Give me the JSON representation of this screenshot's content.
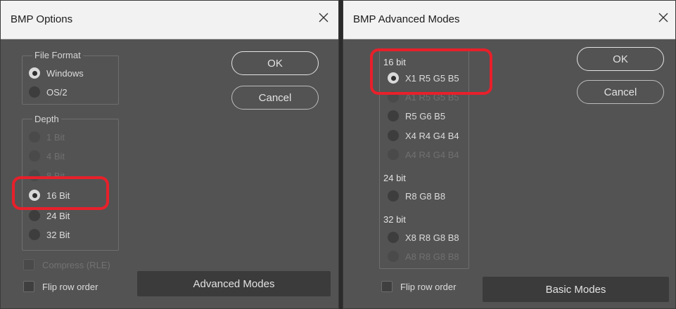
{
  "left_dialog": {
    "title": "BMP Options",
    "close_glyph": "close-icon",
    "file_format": {
      "label": "File Format",
      "options": [
        "Windows",
        "OS/2"
      ],
      "selected": "Windows"
    },
    "depth": {
      "label": "Depth",
      "options": [
        "1 Bit",
        "4 Bit",
        "8 Bit",
        "16 Bit",
        "24 Bit",
        "32 Bit"
      ],
      "selected": "16 Bit",
      "disabled": [
        "1 Bit",
        "4 Bit",
        "8 Bit"
      ]
    },
    "compress_label": "Compress (RLE)",
    "flip_label": "Flip row order",
    "ok_label": "OK",
    "cancel_label": "Cancel",
    "advanced_label": "Advanced Modes"
  },
  "right_dialog": {
    "title": "BMP Advanced Modes",
    "close_glyph": "close-icon",
    "groups": [
      {
        "label": "16 bit",
        "options": [
          "X1 R5 G5 B5",
          "A1 R5 G5 B5",
          "R5 G6 B5",
          "X4 R4 G4 B4",
          "A4 R4 G4 B4"
        ]
      },
      {
        "label": "24 bit",
        "options": [
          "R8 G8 B8"
        ]
      },
      {
        "label": "32 bit",
        "options": [
          "X8 R8 G8 B8",
          "A8 R8 G8 B8"
        ]
      }
    ],
    "selected": "X1 R5 G5 B5",
    "disabled": [
      "A1 R5 G5 B5",
      "A4 R4 G4 B4",
      "A8 R8 G8 B8"
    ],
    "flip_label": "Flip row order",
    "ok_label": "OK",
    "cancel_label": "Cancel",
    "basic_label": "Basic Modes"
  },
  "highlight_color": "#e8202a"
}
